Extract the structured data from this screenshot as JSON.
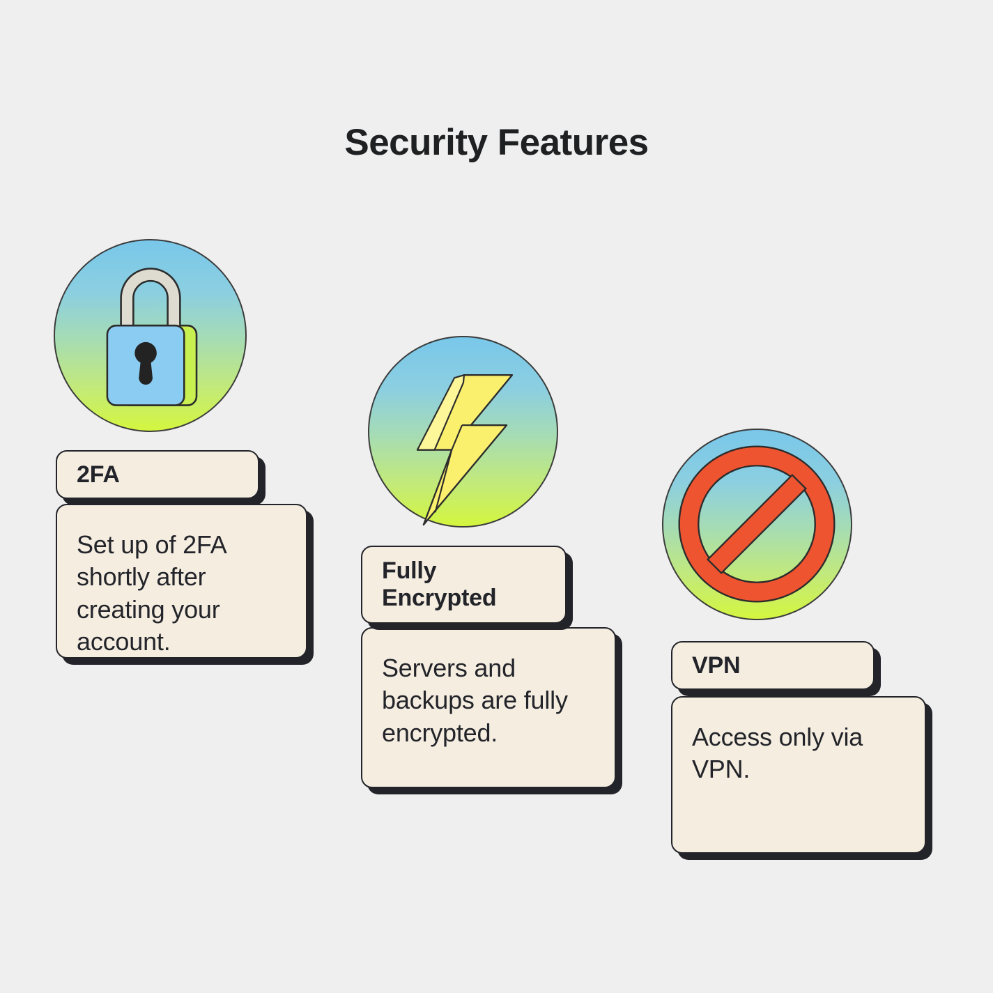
{
  "page": {
    "title": "Security Features",
    "background_color": "#efefef",
    "text_color": "#23242a",
    "card_fill": "#f4ede0",
    "card_border": "#23242a"
  },
  "features": [
    {
      "id": "2fa",
      "icon_name": "padlock-icon",
      "title": "2FA",
      "body": "Set up of 2FA shortly after creating your account.",
      "medallion_gradient_top": "#79c7ea",
      "medallion_gradient_bottom": "#d4f63f",
      "icon_colors": {
        "body": "#8bcdf2",
        "accent": "#c8f050",
        "shackle": "#dedbd0",
        "keyhole": "#232323",
        "outline": "#2c2c2c"
      }
    },
    {
      "id": "encrypted",
      "icon_name": "lightning-bolt-icon",
      "title": "Fully Encrypted",
      "body": "Servers and backups are fully encrypted.",
      "medallion_gradient_top": "#79c7ea",
      "medallion_gradient_bottom": "#d4f63f",
      "icon_colors": {
        "body": "#fbf06e",
        "accent": "#fdf79a",
        "outline": "#2c2c2c"
      }
    },
    {
      "id": "vpn",
      "icon_name": "prohibition-sign-icon",
      "title": "VPN",
      "body": "Access only via VPN.",
      "medallion_gradient_top": "#79c7ea",
      "medallion_gradient_bottom": "#d4f63f",
      "icon_colors": {
        "body": "#ef5430",
        "outline": "#2c2c2c"
      }
    }
  ]
}
